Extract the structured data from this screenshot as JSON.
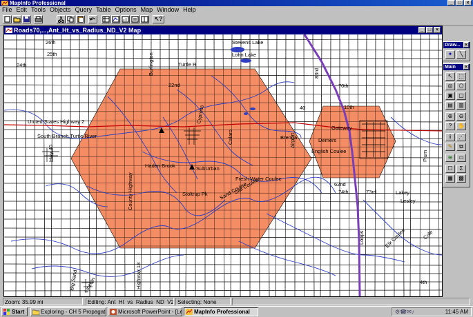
{
  "app": {
    "title": "MapInfo Professional"
  },
  "menu": [
    "File",
    "Edit",
    "Tools",
    "Objects",
    "Query",
    "Table",
    "Options",
    "Map",
    "Window",
    "Help"
  ],
  "map_window": {
    "title": "Roads70,...,Ant_Ht_vs_Radius_ND_V2 Map"
  },
  "map_labels": {
    "us_highway_2": "United States Highway 2",
    "south_branch": "South Branch Turtle River",
    "suburban": "SubUrban",
    "haden_brook": "Haden Brook",
    "fresh_water_coulee": "Fresh Water Coulee",
    "stoltrup_pk": "Stoltrup Pk",
    "brenna": "Brenna",
    "gateway": "Gateway",
    "demers": "Demers",
    "english_coulee": "English Coulee",
    "stevens_lake": "Stevens Lake",
    "lohn_lake": "Lohn Lake",
    "turtle_river": "Turtle R",
    "n26th": "26th",
    "n25th": "25th",
    "n24th": "24th",
    "n22nd": "22nd",
    "n40": "40",
    "n62nd": "62nd",
    "n74th": "74th",
    "n73rd": "73rd",
    "n70th": "70th",
    "n10th": "10th",
    "n4th": "4th",
    "n83rd": "83rd",
    "county_highway": "County Highway",
    "highway18": "Highway 18",
    "sand_coulee": "Sand Coulee",
    "salt_coulee": "Salt Coulee",
    "airport": "Airport",
    "cypress": "Cypress",
    "calaro": "Calaro",
    "lincoln": "Lincoln",
    "plum": "Plum",
    "lakey": "Lakey",
    "lesley": "Lesley",
    "elk_coulee": "Elk Coulee",
    "big_sand": "Big Sand",
    "cole": "Cole",
    "loops": "Loops",
    "burlington": "Burlington",
    "hwy40": "Hwy 40"
  },
  "draw_palette": {
    "title": "Draw..."
  },
  "main_palette": {
    "title": "Main"
  },
  "status": {
    "zoom": "Zoom: 35.99 mi",
    "editing": "Editing: Ant_Ht_vs_Radius_ND_V2",
    "selecting": "Selecting: None"
  },
  "taskbar": {
    "start": "Start",
    "tasks": [
      "Exploring - CH 5 Propagation",
      "Microsoft PowerPoint - [Le...",
      "MapInfo Professional"
    ],
    "clock": "11:45 AM"
  },
  "colors": {
    "coverage": "#f4895f",
    "river": "#2f3fbf",
    "highway": "#7a3fb8",
    "road": "#000000",
    "us2": "#c00000"
  }
}
